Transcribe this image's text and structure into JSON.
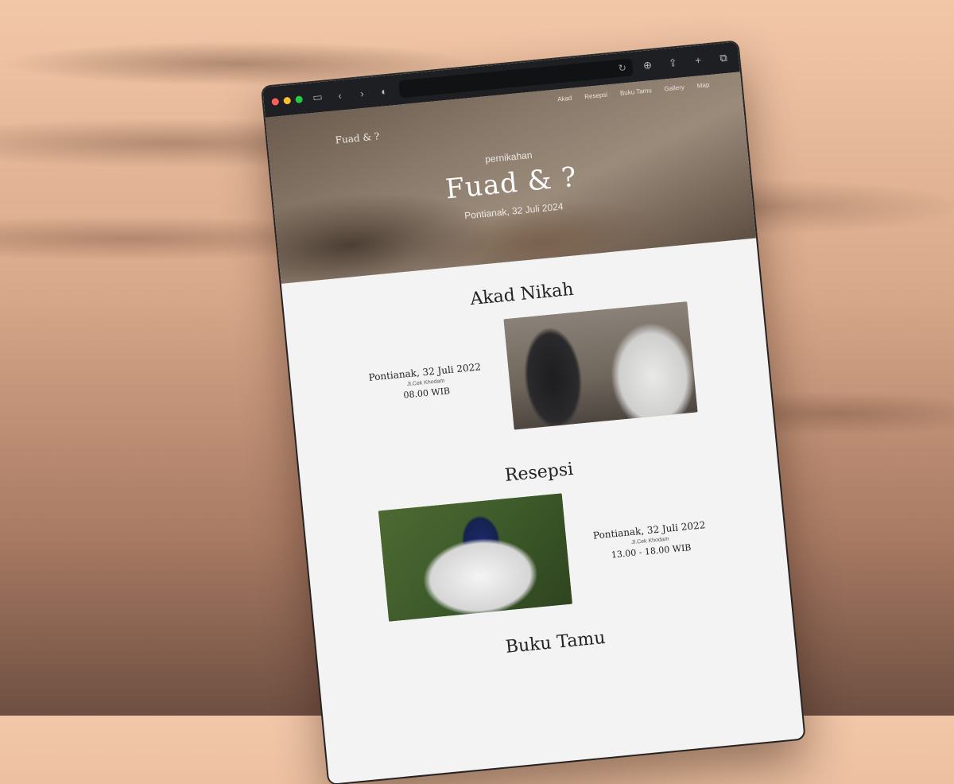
{
  "browser": {
    "nav_back": "‹",
    "nav_forward": "›",
    "icons": [
      "sidebar-icon",
      "shield-icon",
      "reload-icon",
      "download-icon",
      "share-icon",
      "new-tab-icon",
      "tabs-icon"
    ]
  },
  "site": {
    "logo": "Fuad & ?",
    "nav": [
      "Akad",
      "Resepsi",
      "Buku Tamu",
      "Gallery",
      "Map"
    ]
  },
  "hero": {
    "subtitle": "pernikahan",
    "title": "Fuad & ?",
    "date": "Pontianak, 32 Juli 2024"
  },
  "akad": {
    "title": "Akad Nikah",
    "date": "Pontianak, 32 Juli 2022",
    "place": "Jl.Cek Khodam",
    "time": "08.00 WIB"
  },
  "resepsi": {
    "title": "Resepsi",
    "date": "Pontianak, 32 Juli 2022",
    "place": "Jl.Cek Khodam",
    "time": "13.00 - 18.00 WIB"
  },
  "buku_tamu": {
    "title": "Buku Tamu"
  }
}
